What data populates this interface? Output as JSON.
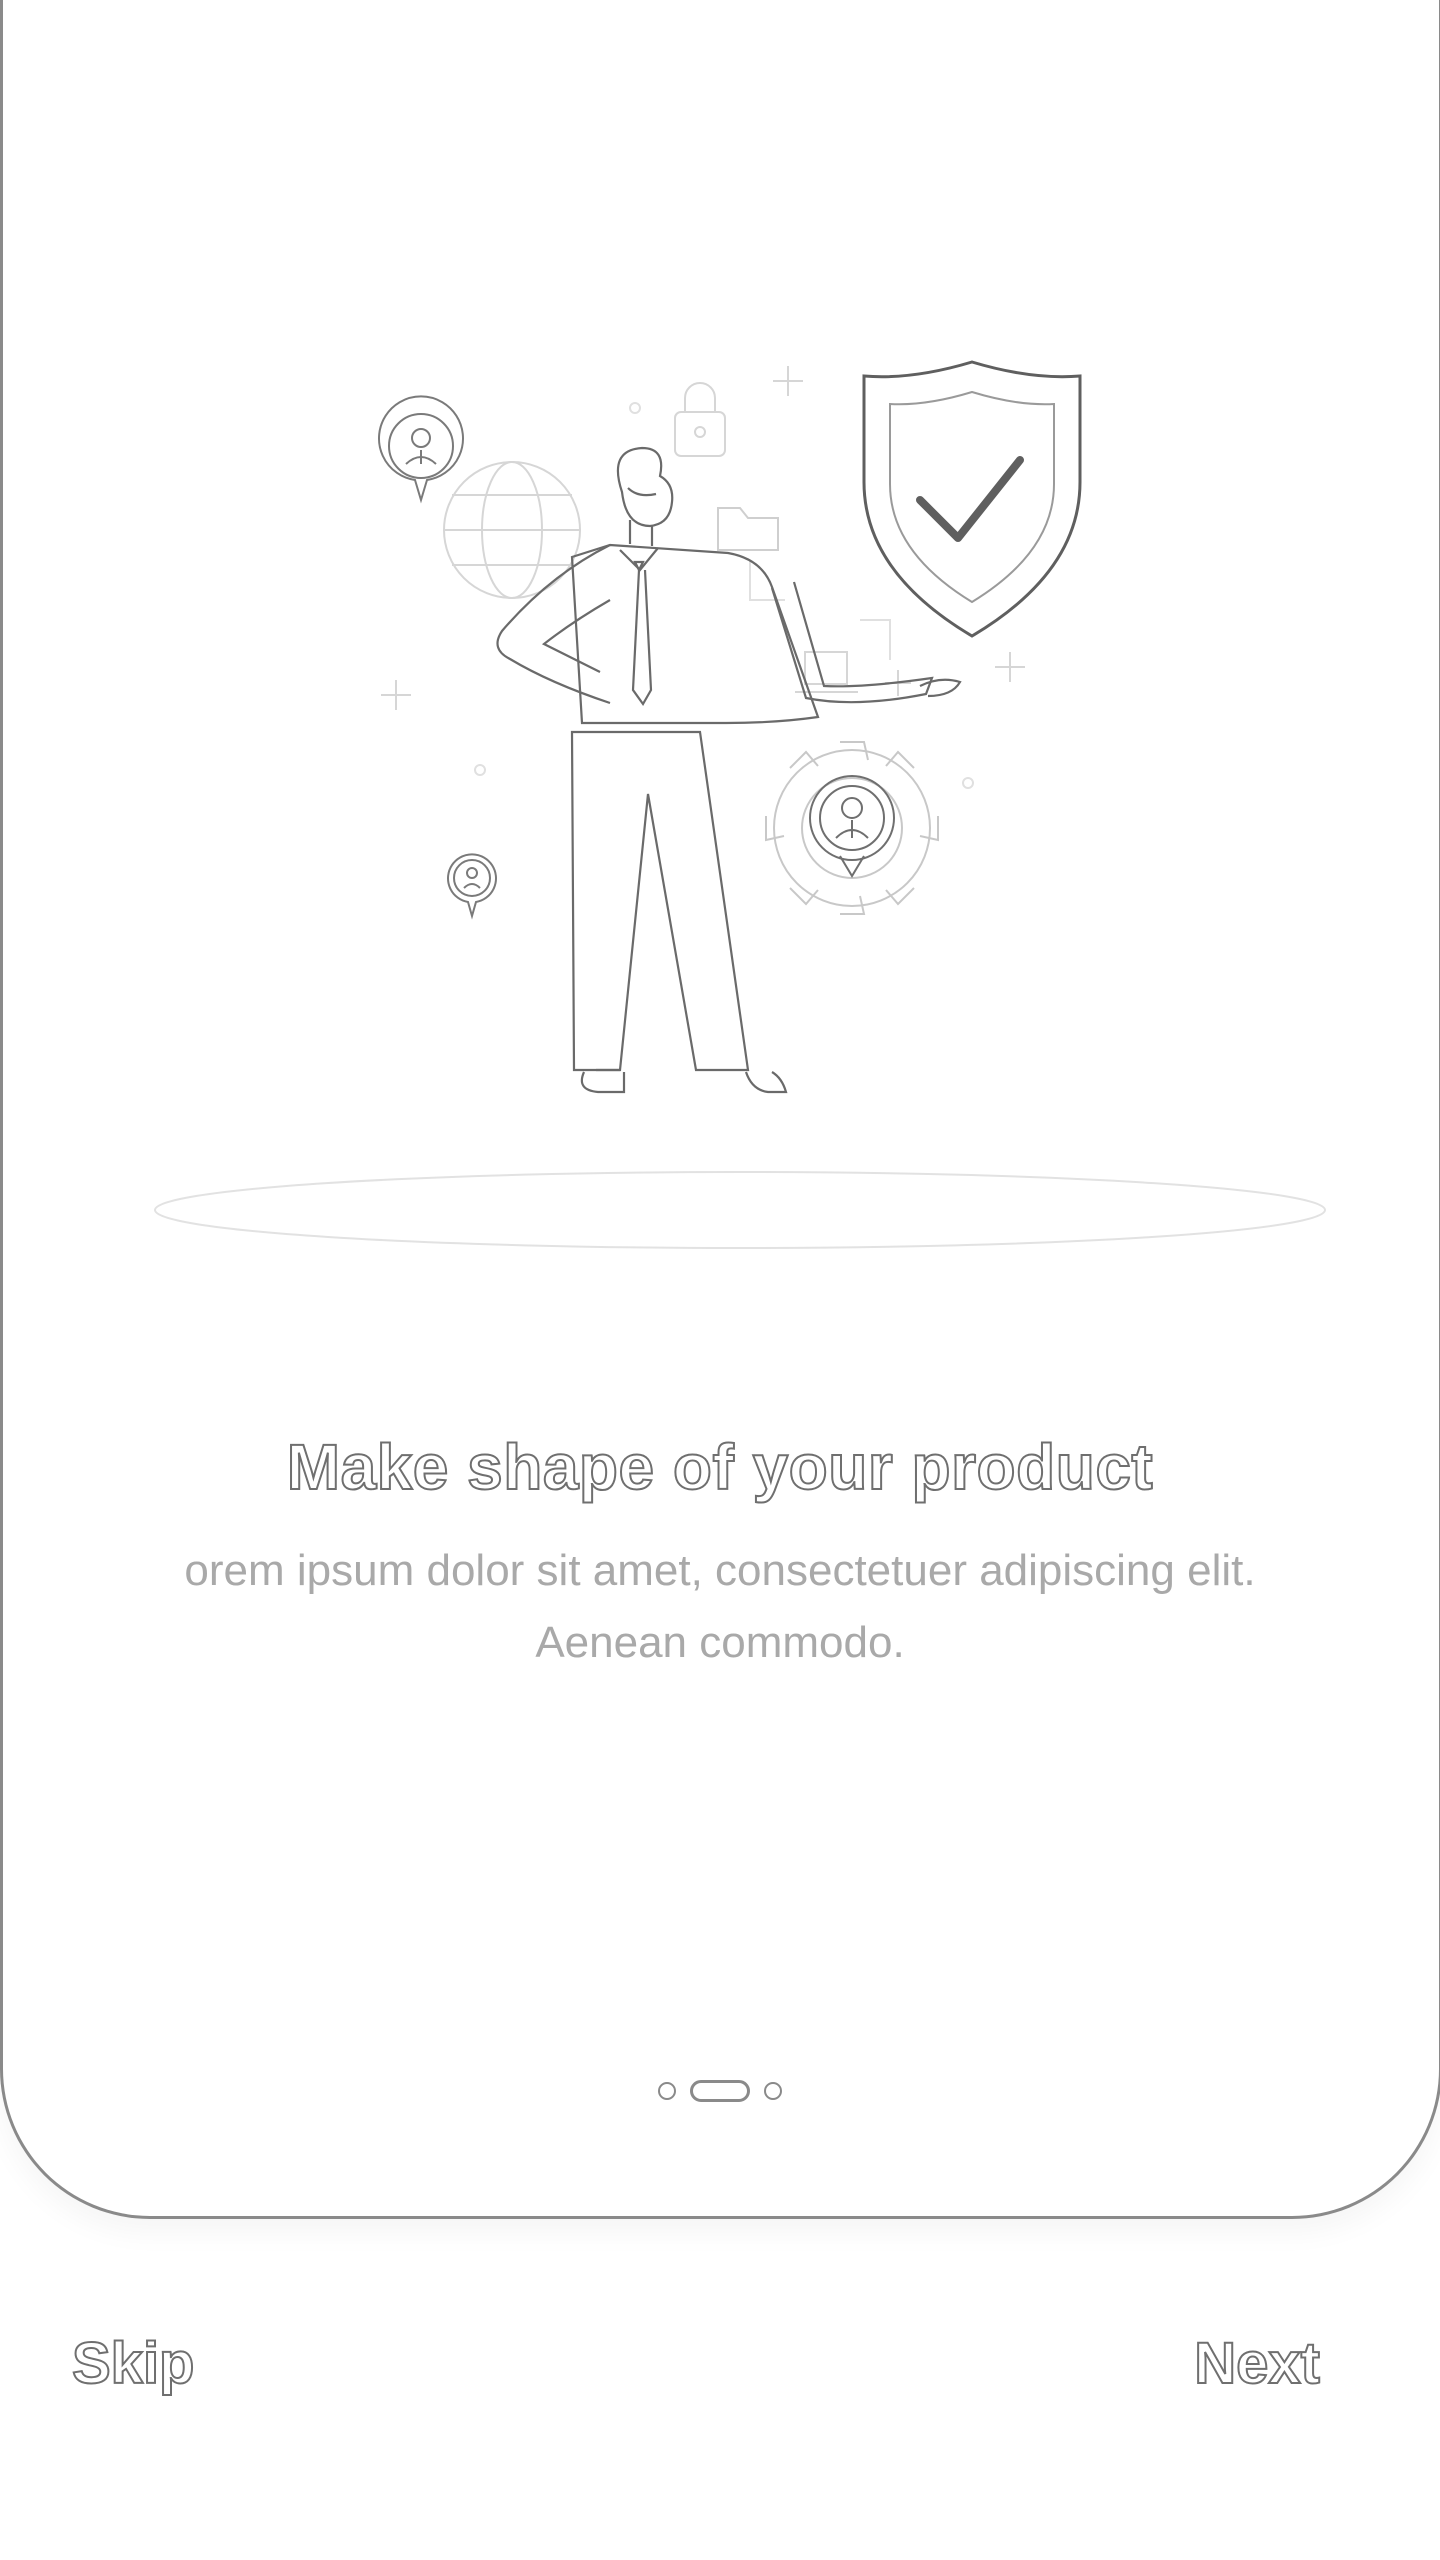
{
  "onboarding": {
    "title": "Make shape of your product",
    "description": "orem ipsum dolor sit amet, consectetuer adipiscing elit. Aenean commodo.",
    "page_indicator": {
      "total": 3,
      "active_index": 1
    },
    "illustration": {
      "subject": "businessman-with-security-icons",
      "icons": [
        "shield-check-icon",
        "globe-icon",
        "padlock-icon",
        "folder-icon",
        "gear-icon",
        "user-pin-icon",
        "laptop-icon",
        "plus-icon"
      ]
    }
  },
  "footer": {
    "skip_label": "Skip",
    "next_label": "Next"
  },
  "colors": {
    "outline": "#6f6f6f",
    "muted_text": "#a9a9a9",
    "background": "#ffffff"
  }
}
